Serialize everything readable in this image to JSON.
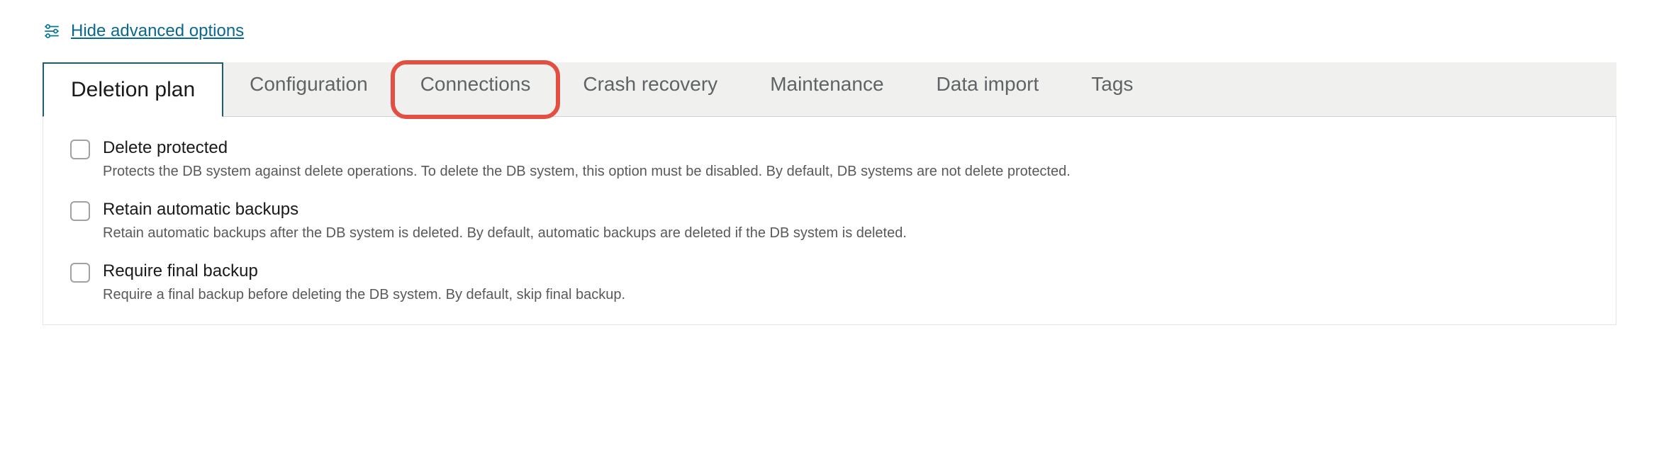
{
  "advanced_options": {
    "link_text": "Hide advanced options"
  },
  "tabs": [
    {
      "label": "Deletion plan",
      "active": true
    },
    {
      "label": "Configuration",
      "active": false
    },
    {
      "label": "Connections",
      "active": false,
      "highlighted": true
    },
    {
      "label": "Crash recovery",
      "active": false
    },
    {
      "label": "Maintenance",
      "active": false
    },
    {
      "label": "Data import",
      "active": false
    },
    {
      "label": "Tags",
      "active": false
    }
  ],
  "deletion_plan": {
    "options": [
      {
        "label": "Delete protected",
        "description": "Protects the DB system against delete operations. To delete the DB system, this option must be disabled. By default, DB systems are not delete protected."
      },
      {
        "label": "Retain automatic backups",
        "description": "Retain automatic backups after the DB system is deleted. By default, automatic backups are deleted if the DB system is deleted."
      },
      {
        "label": "Require final backup",
        "description": "Require a final backup before deleting the DB system. By default, skip final backup."
      }
    ]
  }
}
